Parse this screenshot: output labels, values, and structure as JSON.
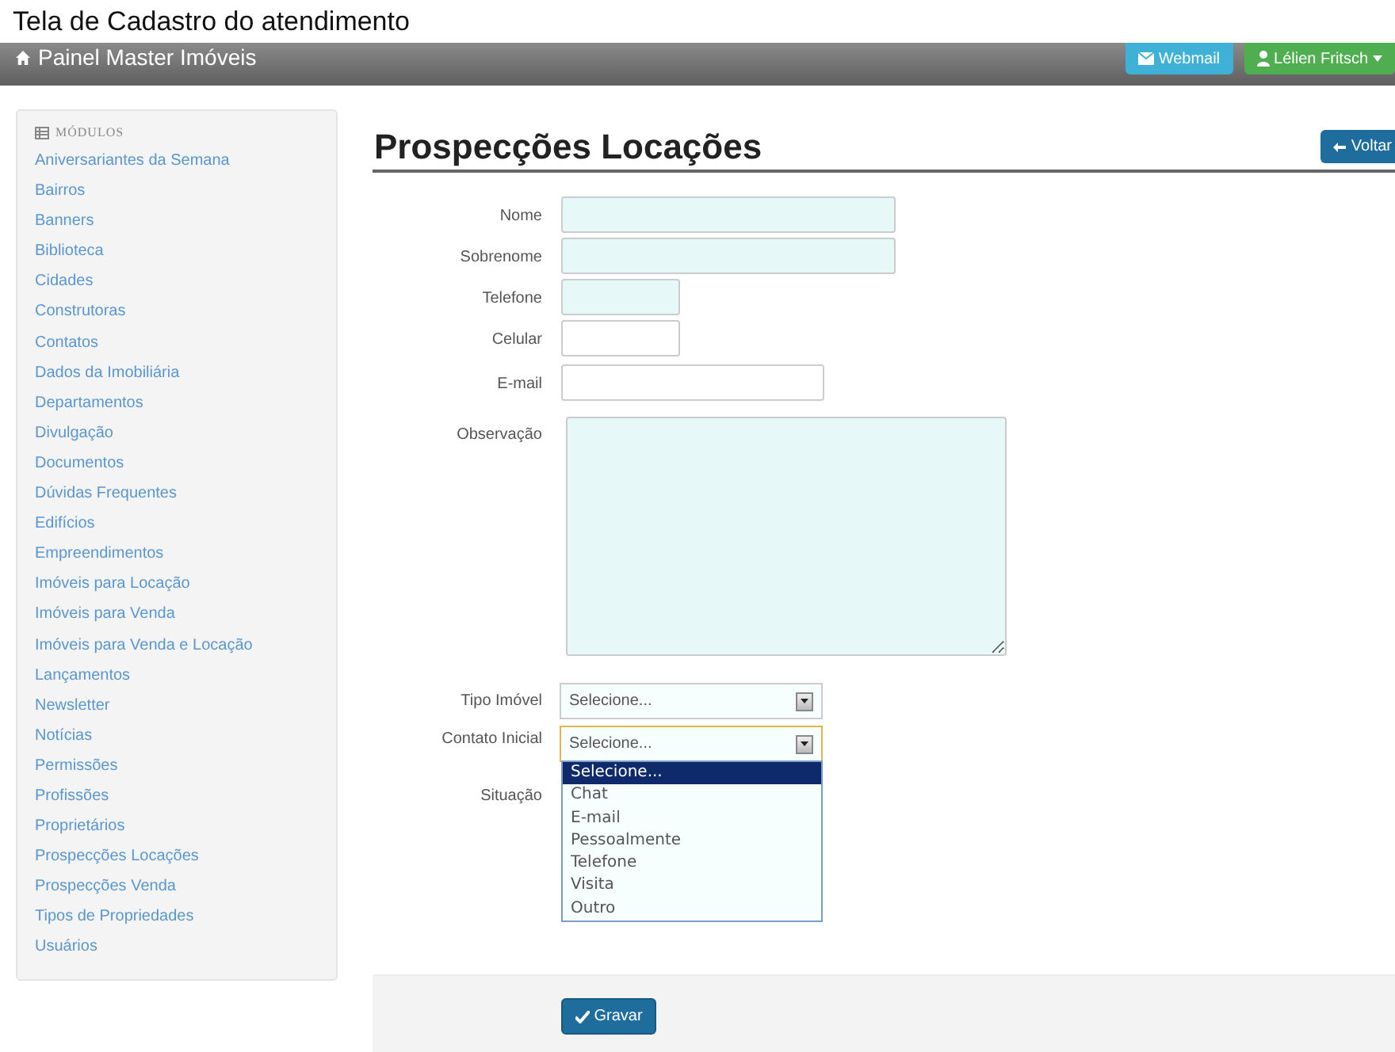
{
  "caption": "Tela de Cadastro do atendimento",
  "navbar": {
    "brand": "Painel Master Imóveis",
    "webmail": "Webmail",
    "user": "Lélien Fritsch"
  },
  "sidebar": {
    "heading": "MÓDULOS",
    "items": [
      "Aniversariantes da Semana",
      "Bairros",
      "Banners",
      "Biblioteca",
      "Cidades",
      "Construtoras",
      "Contatos",
      "Dados da Imobiliária",
      "Departamentos",
      "Divulgação",
      "Documentos",
      "Dúvidas Frequentes",
      "Edifícios",
      "Empreendimentos",
      "Imóveis para Locação",
      "Imóveis para Venda",
      "Imóveis para Venda e Locação",
      "Lançamentos",
      "Newsletter",
      "Notícias",
      "Permissões",
      "Profissões",
      "Proprietários",
      "Prospecções Locações",
      "Prospecções Venda",
      "Tipos de Propriedades",
      "Usuários"
    ]
  },
  "page": {
    "title": "Prospecções Locações",
    "back_button": "Voltar"
  },
  "form": {
    "fields": [
      {
        "label": "Nome",
        "kind": "text",
        "autofilled": true
      },
      {
        "label": "Sobrenome",
        "kind": "text",
        "autofilled": true
      },
      {
        "label": "Telefone",
        "kind": "text",
        "autofilled": true
      },
      {
        "label": "Celular",
        "kind": "text",
        "autofilled": false
      },
      {
        "label": "E-mail",
        "kind": "text",
        "autofilled": false
      },
      {
        "label": "Observação",
        "kind": "textarea",
        "autofilled": true
      },
      {
        "label": "Tipo Imóvel",
        "kind": "select",
        "value": "Selecione...",
        "focused": false
      },
      {
        "label": "Contato Inicial",
        "kind": "select",
        "value": "Selecione...",
        "focused": true,
        "options": [
          {
            "label": "Selecione...",
            "selected": true
          },
          {
            "label": "Chat",
            "selected": false
          },
          {
            "label": "E-mail",
            "selected": false
          },
          {
            "label": "Pessoalmente",
            "selected": false
          },
          {
            "label": "Telefone",
            "selected": false
          },
          {
            "label": "Visita",
            "selected": false
          },
          {
            "label": "Outro",
            "selected": false
          }
        ]
      },
      {
        "label": "Situação",
        "kind": "hidden"
      }
    ]
  },
  "footer": {
    "save_button": "Gravar"
  }
}
